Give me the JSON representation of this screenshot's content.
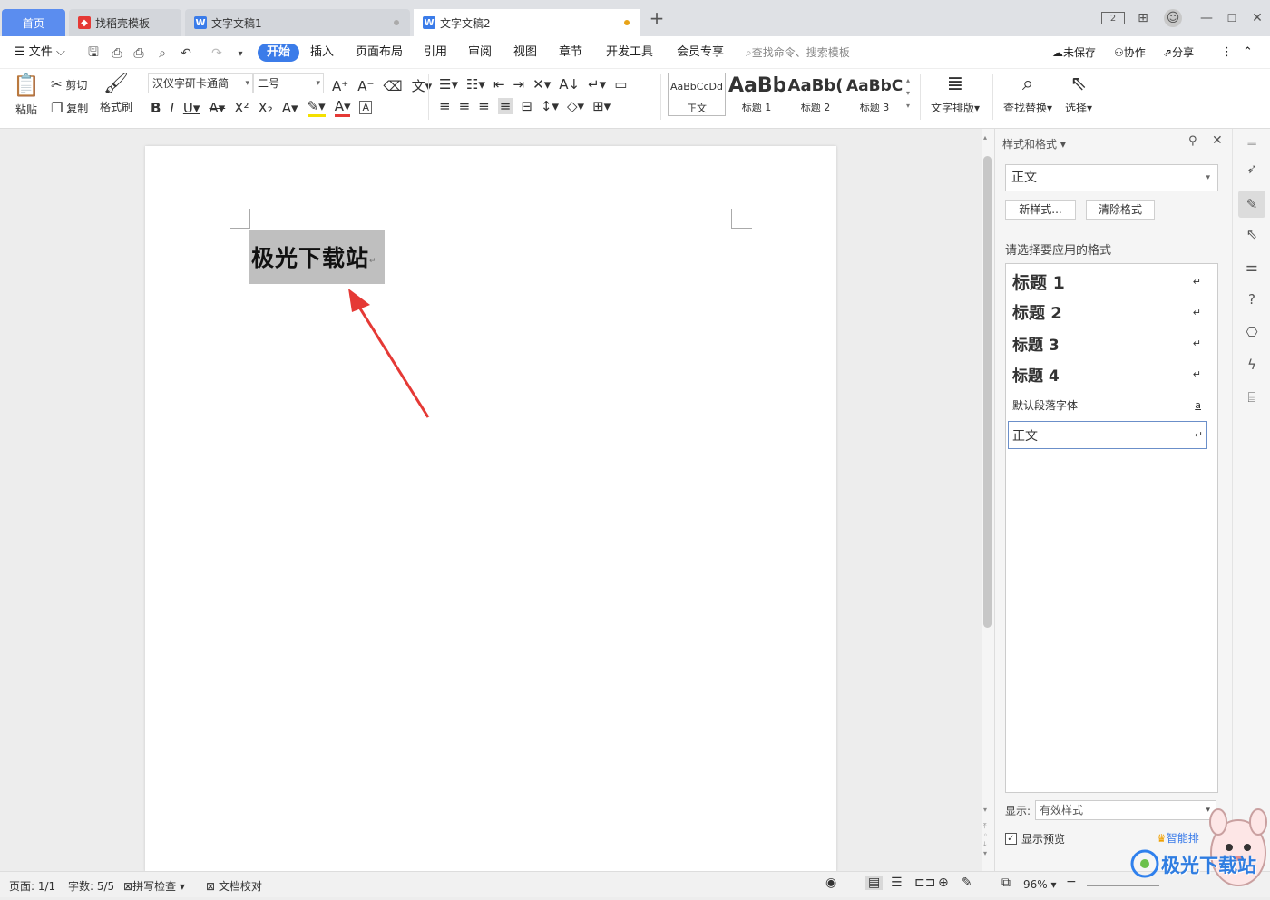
{
  "tabs": {
    "home": "首页",
    "template": "找稻壳模板",
    "doc1": "文字文稿1",
    "doc2": "文字文稿2"
  },
  "window_controls": {
    "layout": "2",
    "minimize": "—",
    "maximize": "☐",
    "close": "✕"
  },
  "menu": {
    "file": "文件",
    "items": [
      "开始",
      "插入",
      "页面布局",
      "引用",
      "审阅",
      "视图",
      "章节",
      "开发工具",
      "会员专享"
    ],
    "search_placeholder": "查找命令、搜索模板",
    "unsaved": "未保存",
    "collab": "协作",
    "share": "分享"
  },
  "ribbon": {
    "paste": "粘贴",
    "cut": "剪切",
    "copy": "复制",
    "format_painter": "格式刷",
    "font_name": "汉仪字研卡通简",
    "font_size": "二号",
    "styles": [
      {
        "preview": "AaBbCcDd",
        "label": "正文"
      },
      {
        "preview": "AaBb",
        "label": "标题 1"
      },
      {
        "preview": "AaBb(",
        "label": "标题 2"
      },
      {
        "preview": "AaBbC(",
        "label": "标题 3"
      }
    ],
    "text_layout": "文字排版",
    "find_replace": "查找替换",
    "select": "选择"
  },
  "document": {
    "text": "极光下载站"
  },
  "side_panel": {
    "title": "样式和格式",
    "current_style": "正文",
    "new_style_btn": "新样式...",
    "clear_format_btn": "清除格式",
    "apply_label": "请选择要应用的格式",
    "styles": [
      {
        "name": "标题  1",
        "marker": "↵"
      },
      {
        "name": "标题  2",
        "marker": "↵"
      },
      {
        "name": "标题  3",
        "marker": "↵"
      },
      {
        "name": "标题  4",
        "marker": "↵"
      },
      {
        "name": "默认段落字体",
        "marker": "a"
      },
      {
        "name": "正文",
        "marker": "↵"
      }
    ],
    "show_label": "显示:",
    "show_value": "有效样式",
    "preview_label": "显示预览",
    "smart_layout": "智能排"
  },
  "status": {
    "page": "页面: 1/1",
    "words": "字数: 5/5",
    "spell_check": "拼写检查",
    "doc_check": "文档校对",
    "zoom": "96%"
  },
  "watermark": "极光下载站",
  "colors": {
    "accent": "#3b7ce9",
    "home_tab": "#5b8def",
    "arrow": "#e53935",
    "highlight": "#bfbfbf"
  }
}
